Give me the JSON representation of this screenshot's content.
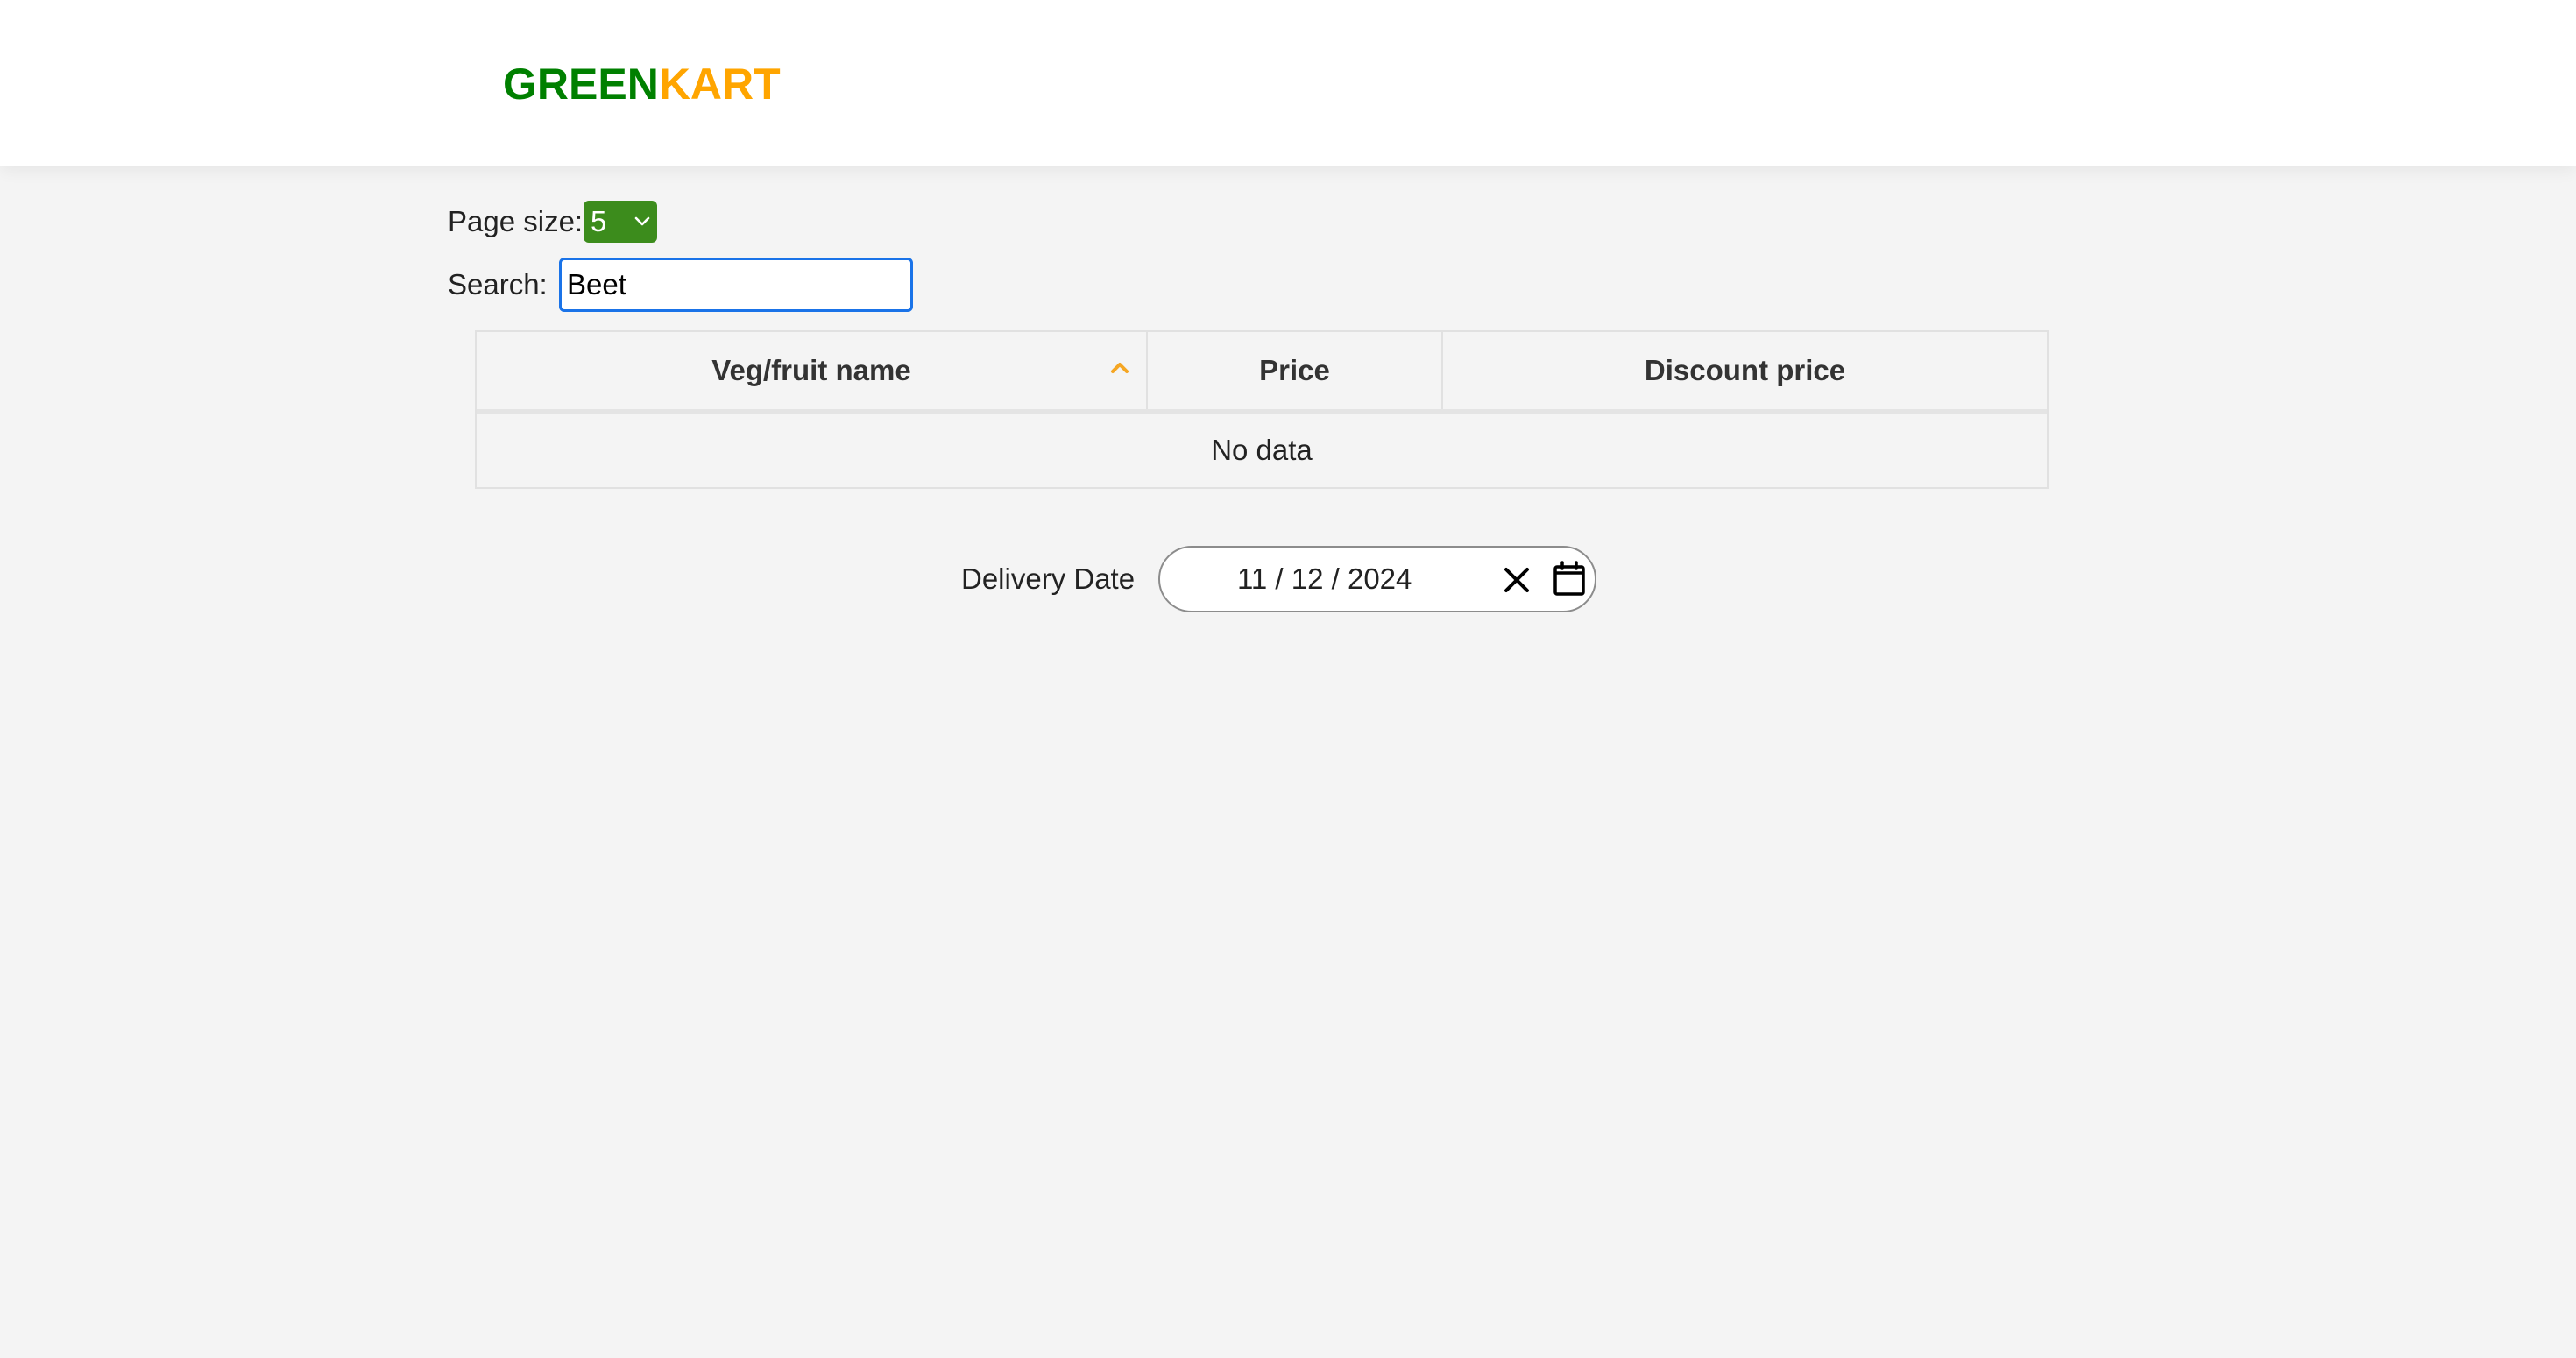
{
  "header": {
    "logo_part1": "GREEN",
    "logo_part2": "KART"
  },
  "controls": {
    "page_size_label": "Page size:",
    "page_size_value": "5",
    "search_label": "Search:",
    "search_value": "Beet"
  },
  "table": {
    "columns": [
      "Veg/fruit name",
      "Price",
      "Discount price"
    ],
    "sort": {
      "column": "Veg/fruit name",
      "direction": "ascending"
    },
    "empty_text": "No data"
  },
  "delivery": {
    "label": "Delivery Date",
    "date_value": "11 / 12 / 2024"
  },
  "colors": {
    "logo_green": "#008000",
    "logo_orange": "#ffa500",
    "select_bg": "#3c8c1c",
    "focus_border": "#1a73e8",
    "sort_icon": "#f5a623"
  },
  "icons": {
    "page_size_select": "chevron-down-icon",
    "sort": "chevron-up-icon",
    "date_clear": "close-icon",
    "date_picker": "calendar-icon"
  }
}
